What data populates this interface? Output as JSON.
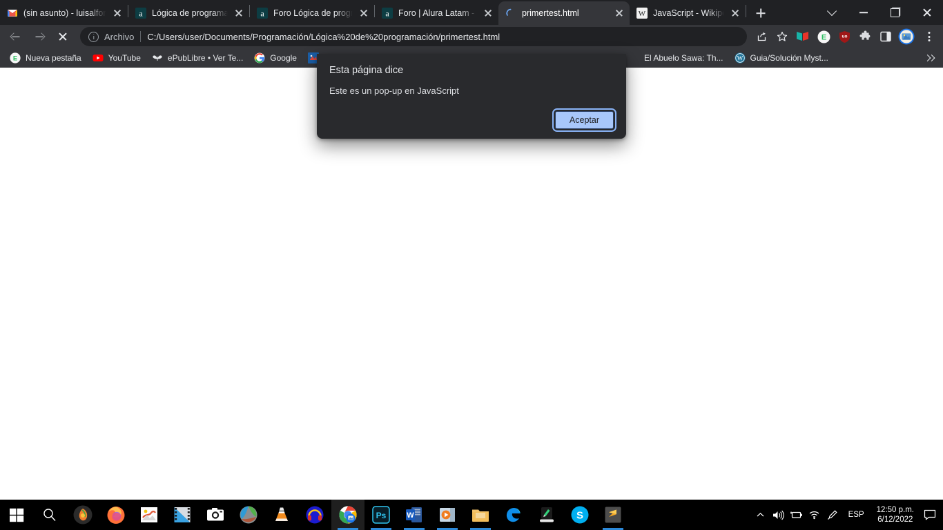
{
  "browser": {
    "tabs": [
      {
        "title": "(sin asunto) - luisalfon",
        "icon": "gmail-icon",
        "active": false
      },
      {
        "title": "Lógica de programaci",
        "icon": "alura-icon",
        "active": false
      },
      {
        "title": "Foro Lógica de progra",
        "icon": "alura-icon",
        "active": false
      },
      {
        "title": "Foro | Alura Latam - C",
        "icon": "alura-icon",
        "active": false
      },
      {
        "title": "primertest.html",
        "icon": "loading-spinner-icon",
        "active": true
      },
      {
        "title": "JavaScript - Wikipedia",
        "icon": "wikipedia-icon",
        "active": false
      }
    ],
    "new_tab_label": "+",
    "window_controls": {
      "chevron": "chevron-down-icon",
      "minimize": "minimize-icon",
      "maximize": "maximize-icon",
      "close": "close-icon"
    },
    "toolbar": {
      "back": "back-arrow-icon",
      "forward": "forward-arrow-icon",
      "stop": "stop-loading-icon",
      "scheme_label": "Archivo",
      "url": "C:/Users/user/Documents/Programación/Lógica%20de%20programación/primertest.html",
      "share": "share-icon",
      "bookmark": "star-icon",
      "extensions": [
        {
          "name": "flag-extension-icon",
          "color": "#18b3a7"
        },
        {
          "name": "evernote-extension-icon",
          "color": "#2dbe60",
          "letter": "E"
        },
        {
          "name": "ublock-origin-icon",
          "color": "#a01717",
          "letter": "uo"
        },
        {
          "name": "puzzle-extensions-icon",
          "color": "#d9dadd"
        },
        {
          "name": "side-panel-icon",
          "color": "#ffffff"
        }
      ],
      "profile": "profile-avatar",
      "menu": "three-dot-menu-icon"
    },
    "bookmarks": [
      {
        "label": "Nueva pestaña",
        "icon": "evernote-icon"
      },
      {
        "label": "YouTube",
        "icon": "youtube-icon"
      },
      {
        "label": "ePubLibre • Ver Te...",
        "icon": "epublibre-icon"
      },
      {
        "label": "Google",
        "icon": "google-icon"
      },
      {
        "label": "",
        "icon": "blue-site-icon"
      },
      {
        "label": "El Abuelo Sawa: Th...",
        "icon": "blank-icon"
      },
      {
        "label": "Guia/Solución Myst...",
        "icon": "wordpress-icon"
      }
    ],
    "bookmarks_overflow": "chevron-double-right-icon"
  },
  "dialog": {
    "title": "Esta página dice",
    "message": "Este es un pop-up en JavaScript",
    "accept_label": "Aceptar"
  },
  "taskbar": {
    "apps": [
      {
        "name": "start-button-icon",
        "active": false
      },
      {
        "name": "search-icon",
        "active": false
      },
      {
        "name": "fl-studio-icon",
        "active": false
      },
      {
        "name": "firefox-icon",
        "active": false
      },
      {
        "name": "white-app-icon",
        "active": false
      },
      {
        "name": "video-editor-icon",
        "active": false
      },
      {
        "name": "camera-app-icon",
        "active": false
      },
      {
        "name": "green-globe-app-icon",
        "active": false
      },
      {
        "name": "vlc-icon",
        "active": false
      },
      {
        "name": "headphones-app-icon",
        "active": false
      },
      {
        "name": "chrome-icon",
        "active": true
      },
      {
        "name": "photoshop-icon",
        "active": false
      },
      {
        "name": "word-icon",
        "active": false
      },
      {
        "name": "media-player-icon",
        "active": false
      },
      {
        "name": "file-explorer-icon",
        "active": false
      },
      {
        "name": "edge-icon",
        "active": false
      },
      {
        "name": "green-note-app-icon",
        "active": false
      },
      {
        "name": "skype-icon",
        "active": false
      },
      {
        "name": "sublime-text-icon",
        "active": false
      }
    ],
    "tray": {
      "show_hidden": "chevron-up-icon",
      "volume": "speaker-icon",
      "battery": "battery-icon",
      "network": "wifi-icon",
      "pen": "pen-icon",
      "language": "ESP",
      "time": "12:50 p.m.",
      "date": "6/12/2022",
      "notifications": "notification-icon"
    }
  }
}
